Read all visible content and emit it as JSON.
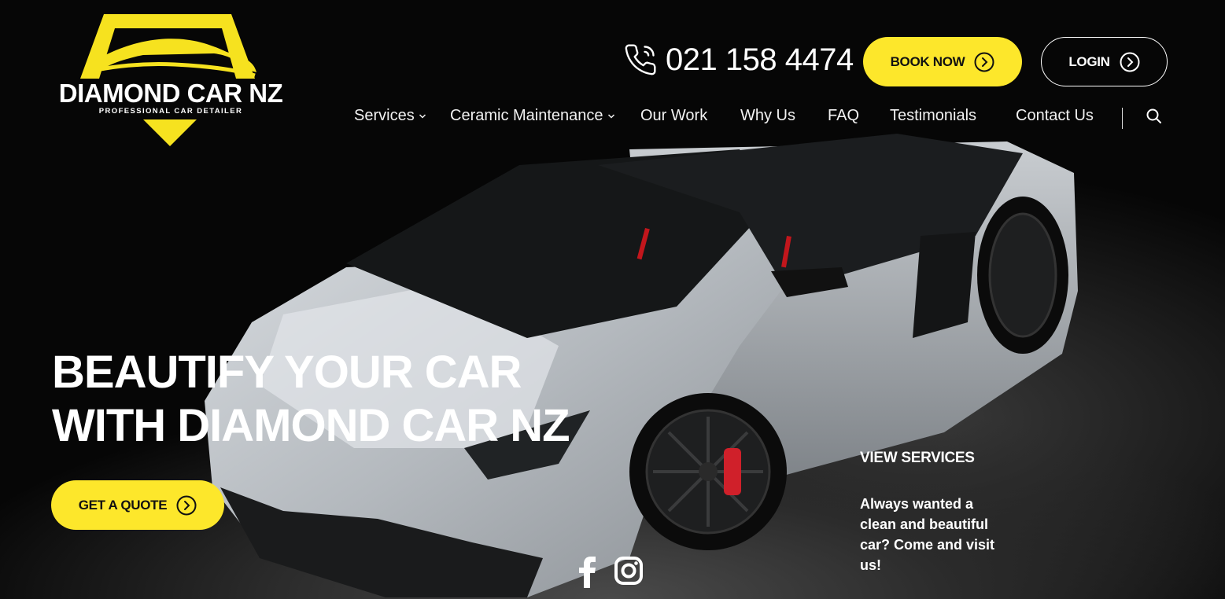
{
  "brand": {
    "name": "DIAMOND CAR NZ",
    "tagline": "PROFESSIONAL CAR DETAILER",
    "accent_color": "#fde72b"
  },
  "header": {
    "phone": "021 158 4474",
    "phone_icon": "phone-icon",
    "book_now": "BOOK NOW",
    "login": "LOGIN"
  },
  "nav": {
    "items": [
      {
        "label": "Services",
        "has_dropdown": true
      },
      {
        "label": "Ceramic Maintenance",
        "has_dropdown": true
      },
      {
        "label": "Our Work",
        "has_dropdown": false
      },
      {
        "label": "Why Us",
        "has_dropdown": false
      },
      {
        "label": "FAQ",
        "has_dropdown": false
      },
      {
        "label": "Testimonials",
        "has_dropdown": false
      },
      {
        "label": "Contact Us",
        "has_dropdown": false
      }
    ],
    "search_icon": "search-icon"
  },
  "hero": {
    "headline_line1": "BEAUTIFY YOUR CAR",
    "headline_line2": "WITH DIAMOND CAR NZ",
    "cta": "GET A QUOTE",
    "view_services": "VIEW SERVICES",
    "description": "Always wanted a clean and beautiful car? Come and visit us!"
  },
  "social": [
    "facebook-icon",
    "instagram-icon"
  ]
}
